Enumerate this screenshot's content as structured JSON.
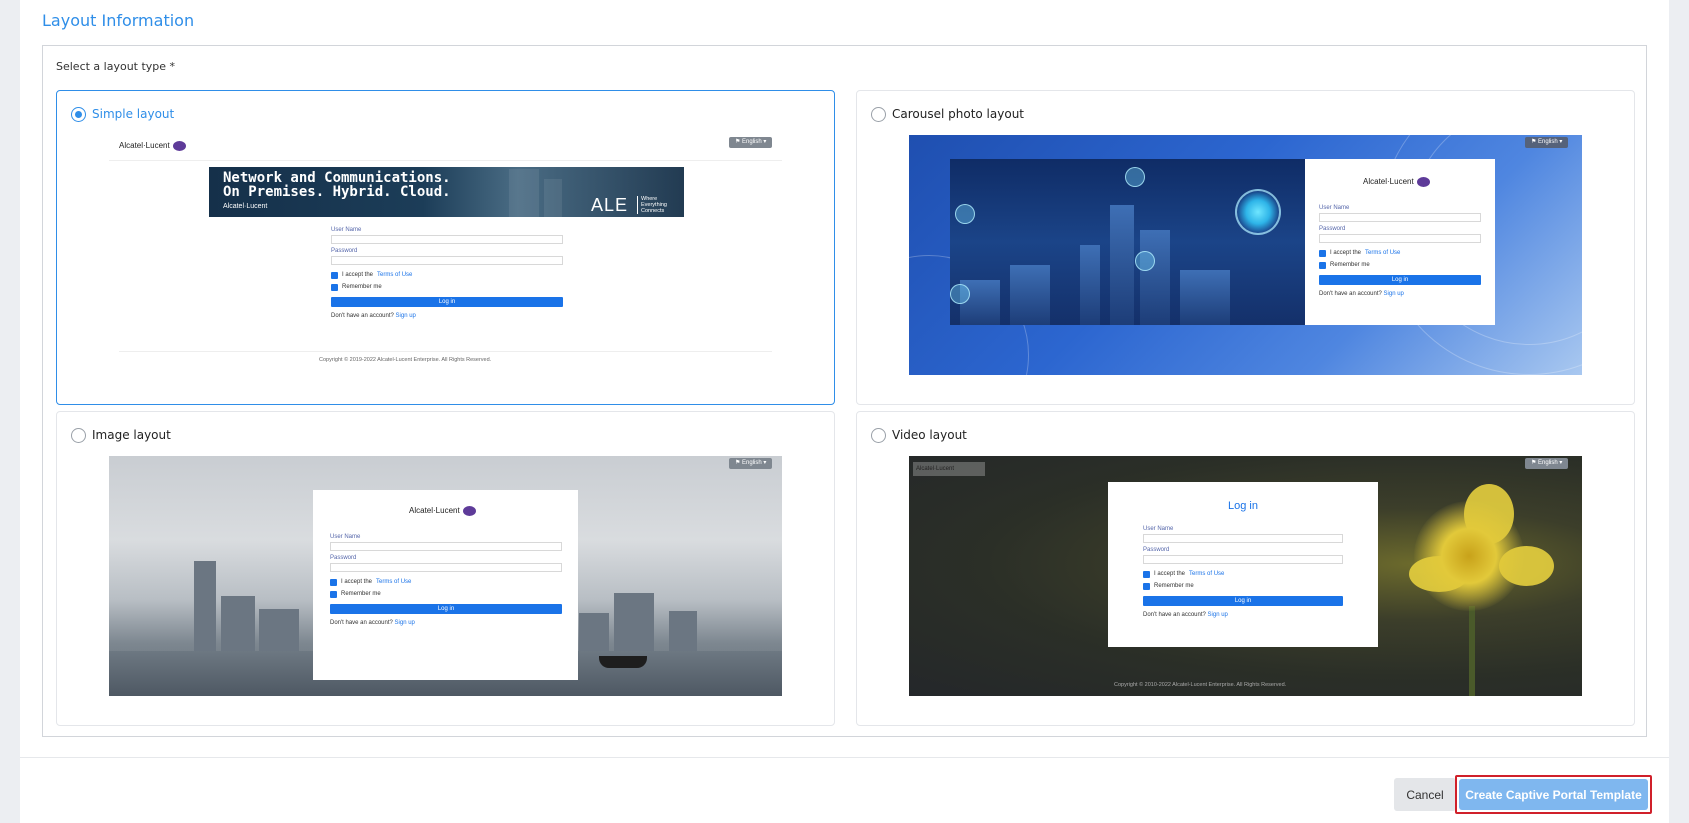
{
  "section": {
    "title": "Layout Information"
  },
  "field": {
    "label": "Select a layout type *",
    "selected": "simple"
  },
  "layouts": {
    "simple": {
      "label": "Simple layout"
    },
    "carousel": {
      "label": "Carousel photo layout"
    },
    "image": {
      "label": "Image layout"
    },
    "video": {
      "label": "Video layout"
    }
  },
  "preview": {
    "logo": "Alcatel·Lucent",
    "logo_sub": "Enterprise",
    "lang": "English",
    "banner_line1": "Network and Communications.",
    "banner_line2": "On Premises. Hybrid. Cloud.",
    "banner_logo": "Alcatel·Lucent",
    "banner_ale": "ALE",
    "banner_tag1": "Where",
    "banner_tag2": "Everything",
    "banner_tag3": "Connects",
    "user_name": "User Name",
    "password": "Password",
    "accept_prefix": "I accept the",
    "accept_link": "Terms of Use",
    "remember": "Remember me",
    "login_button": "Log in",
    "no_account": "Don't have an account?",
    "sign_up": "Sign up",
    "copyright_simple": "Copyright © 2019-2022 Alcatel-Lucent Enterprise. All Rights Reserved.",
    "copyright_video": "Copyright © 2010-2022 Alcatel-Lucent Enterprise. All Rights Reserved.",
    "login_title": "Log in"
  },
  "actions": {
    "cancel": "Cancel",
    "create": "Create Captive Portal Template"
  },
  "colors": {
    "accent": "#2f8ee8",
    "primary_button": "#7fb7ef",
    "highlight_border": "#d0202a"
  }
}
